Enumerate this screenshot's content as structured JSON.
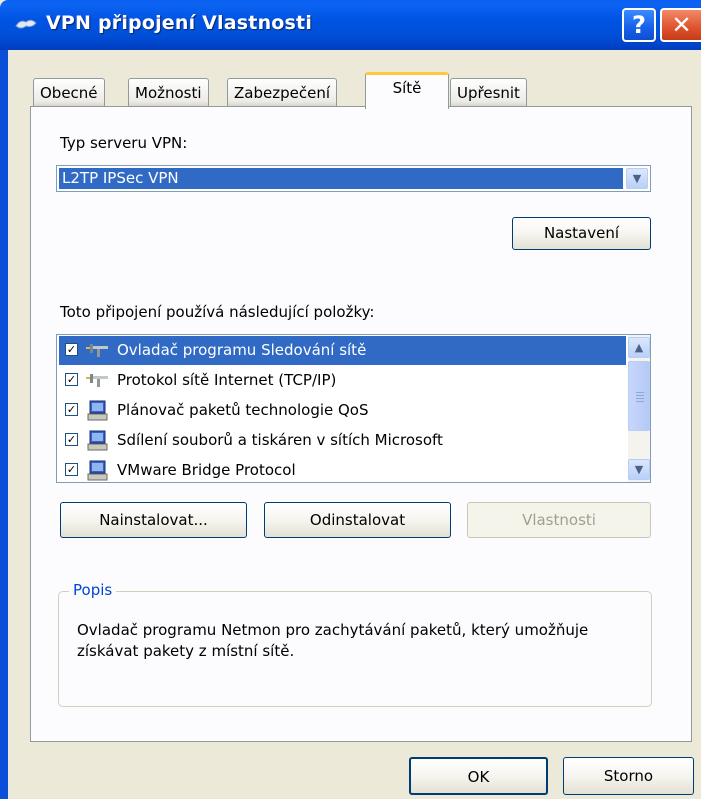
{
  "window": {
    "title": "VPN připojení Vlastnosti",
    "help_label": "?",
    "close_label": "✕"
  },
  "tabs": [
    {
      "label": "Obecné",
      "active": false
    },
    {
      "label": "Možnosti",
      "active": false
    },
    {
      "label": "Zabezpečení",
      "active": false
    },
    {
      "label": "Sítě",
      "active": true
    },
    {
      "label": "Upřesnit",
      "active": false
    }
  ],
  "vpn_type": {
    "label": "Typ serveru VPN:",
    "selected": "L2TP IPSec VPN"
  },
  "settings_button": "Nastavení",
  "items": {
    "label": "Toto připojení používá následující položky:",
    "rows": [
      {
        "label": "Ovladač programu Sledování sítě",
        "checked": true,
        "icon": "protocol-icon",
        "selected": true
      },
      {
        "label": "Protokol sítě Internet (TCP/IP)",
        "checked": true,
        "icon": "protocol-icon",
        "selected": false
      },
      {
        "label": "Plánovač paketů technologie QoS",
        "checked": true,
        "icon": "service-computer-icon",
        "selected": false
      },
      {
        "label": "Sdílení souborů a tiskáren v sítích Microsoft",
        "checked": true,
        "icon": "service-computer-icon",
        "selected": false
      },
      {
        "label": "VMware Bridge Protocol",
        "checked": true,
        "icon": "service-computer-icon",
        "selected": false
      }
    ]
  },
  "buttons": {
    "install": "Nainstalovat...",
    "uninstall": "Odinstalovat",
    "properties": "Vlastnosti",
    "ok": "OK",
    "cancel": "Storno"
  },
  "description": {
    "title": "Popis",
    "text": "Ovladač programu Netmon pro zachytávání paketů, který umožňuje získávat pakety z místní sítě."
  },
  "colors": {
    "title_bar": "#0054e3",
    "selection": "#316ac5",
    "active_tab_accent": "#ffc83c",
    "group_title": "#0046d5"
  }
}
